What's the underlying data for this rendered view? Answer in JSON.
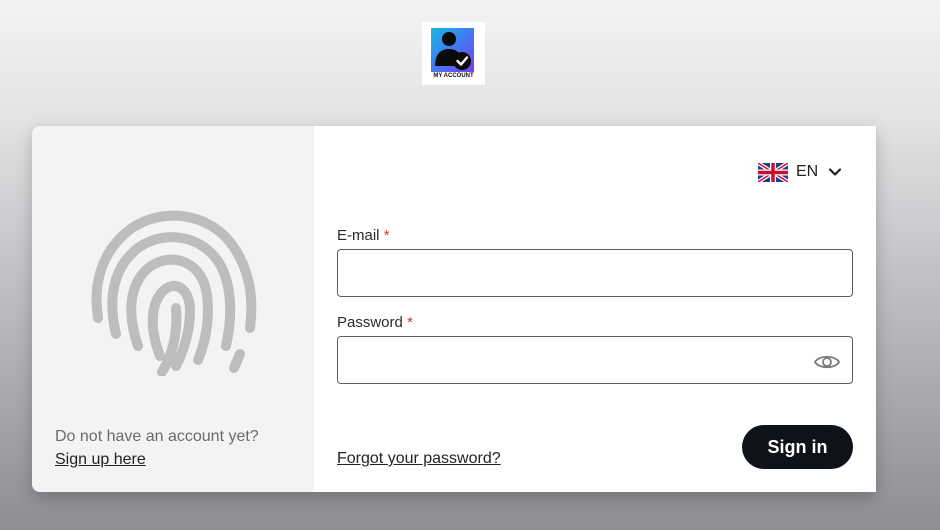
{
  "logo": {
    "caption": "MY ACCOUNT",
    "icon": "user-check-icon"
  },
  "left_panel": {
    "icon": "fingerprint-icon",
    "signup_prompt": "Do not have an account yet?",
    "signup_link": "Sign up here"
  },
  "language": {
    "code": "EN",
    "flag": "uk-flag-icon"
  },
  "form": {
    "email_label": "E-mail",
    "email_value": "",
    "password_label": "Password",
    "password_value": "",
    "required_mark": "*",
    "forgot_link": "Forgot your password?",
    "submit_label": "Sign in"
  },
  "colors": {
    "accent_button": "#0f1219",
    "required": "#e0302f",
    "left_panel_bg": "#f3f3f3",
    "fingerprint": "#bdbdbd"
  }
}
